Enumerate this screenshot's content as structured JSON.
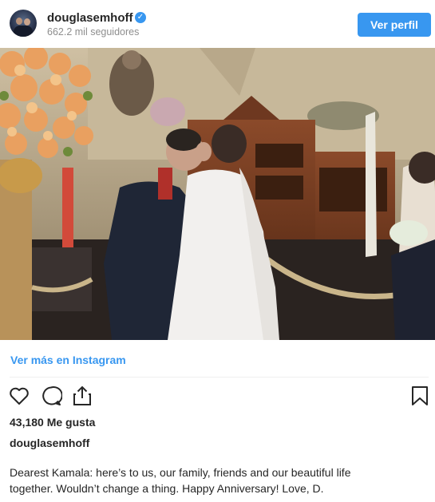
{
  "header": {
    "username": "douglasemhoff",
    "verified_glyph": "✓",
    "followers": "662.2 mil seguidores",
    "view_profile_label": "Ver perfil"
  },
  "photo": {
    "description_icon": "wedding-photo"
  },
  "more_link": "Ver más en Instagram",
  "actions": {
    "icons": [
      "heart-icon",
      "comment-icon",
      "share-icon",
      "bookmark-icon"
    ]
  },
  "likes": "43,180 Me gusta",
  "caption": {
    "username": "douglasemhoff",
    "line1": "Dearest Kamala: here’s to us, our family, friends and our beautiful life",
    "line2": "together. Wouldn’t change a thing. Happy Anniversary! Love, D."
  },
  "colors": {
    "accent": "#3897f0",
    "text": "#262626",
    "muted": "#8e8e8e"
  }
}
